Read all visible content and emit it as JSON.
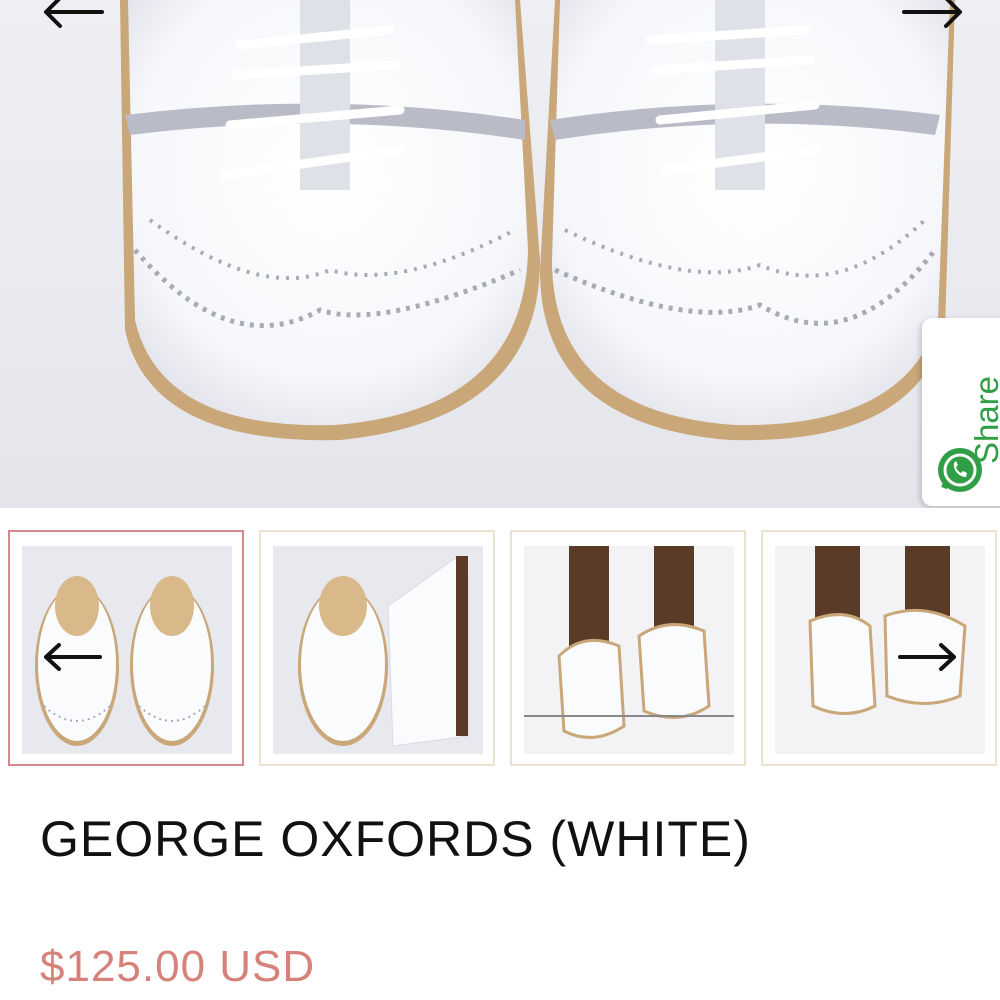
{
  "hero": {
    "prev_icon": "arrow-left-icon",
    "next_icon": "arrow-right-icon"
  },
  "share": {
    "label": "Share",
    "icon": "whatsapp-icon",
    "color": "#2f9e44"
  },
  "thumbnails": [
    {
      "active": true
    },
    {
      "active": false
    },
    {
      "active": false
    },
    {
      "active": false
    }
  ],
  "product": {
    "title": "GEORGE OXFORDS (WHITE)",
    "price": "$125.00 USD",
    "price_color": "#d6817a"
  }
}
